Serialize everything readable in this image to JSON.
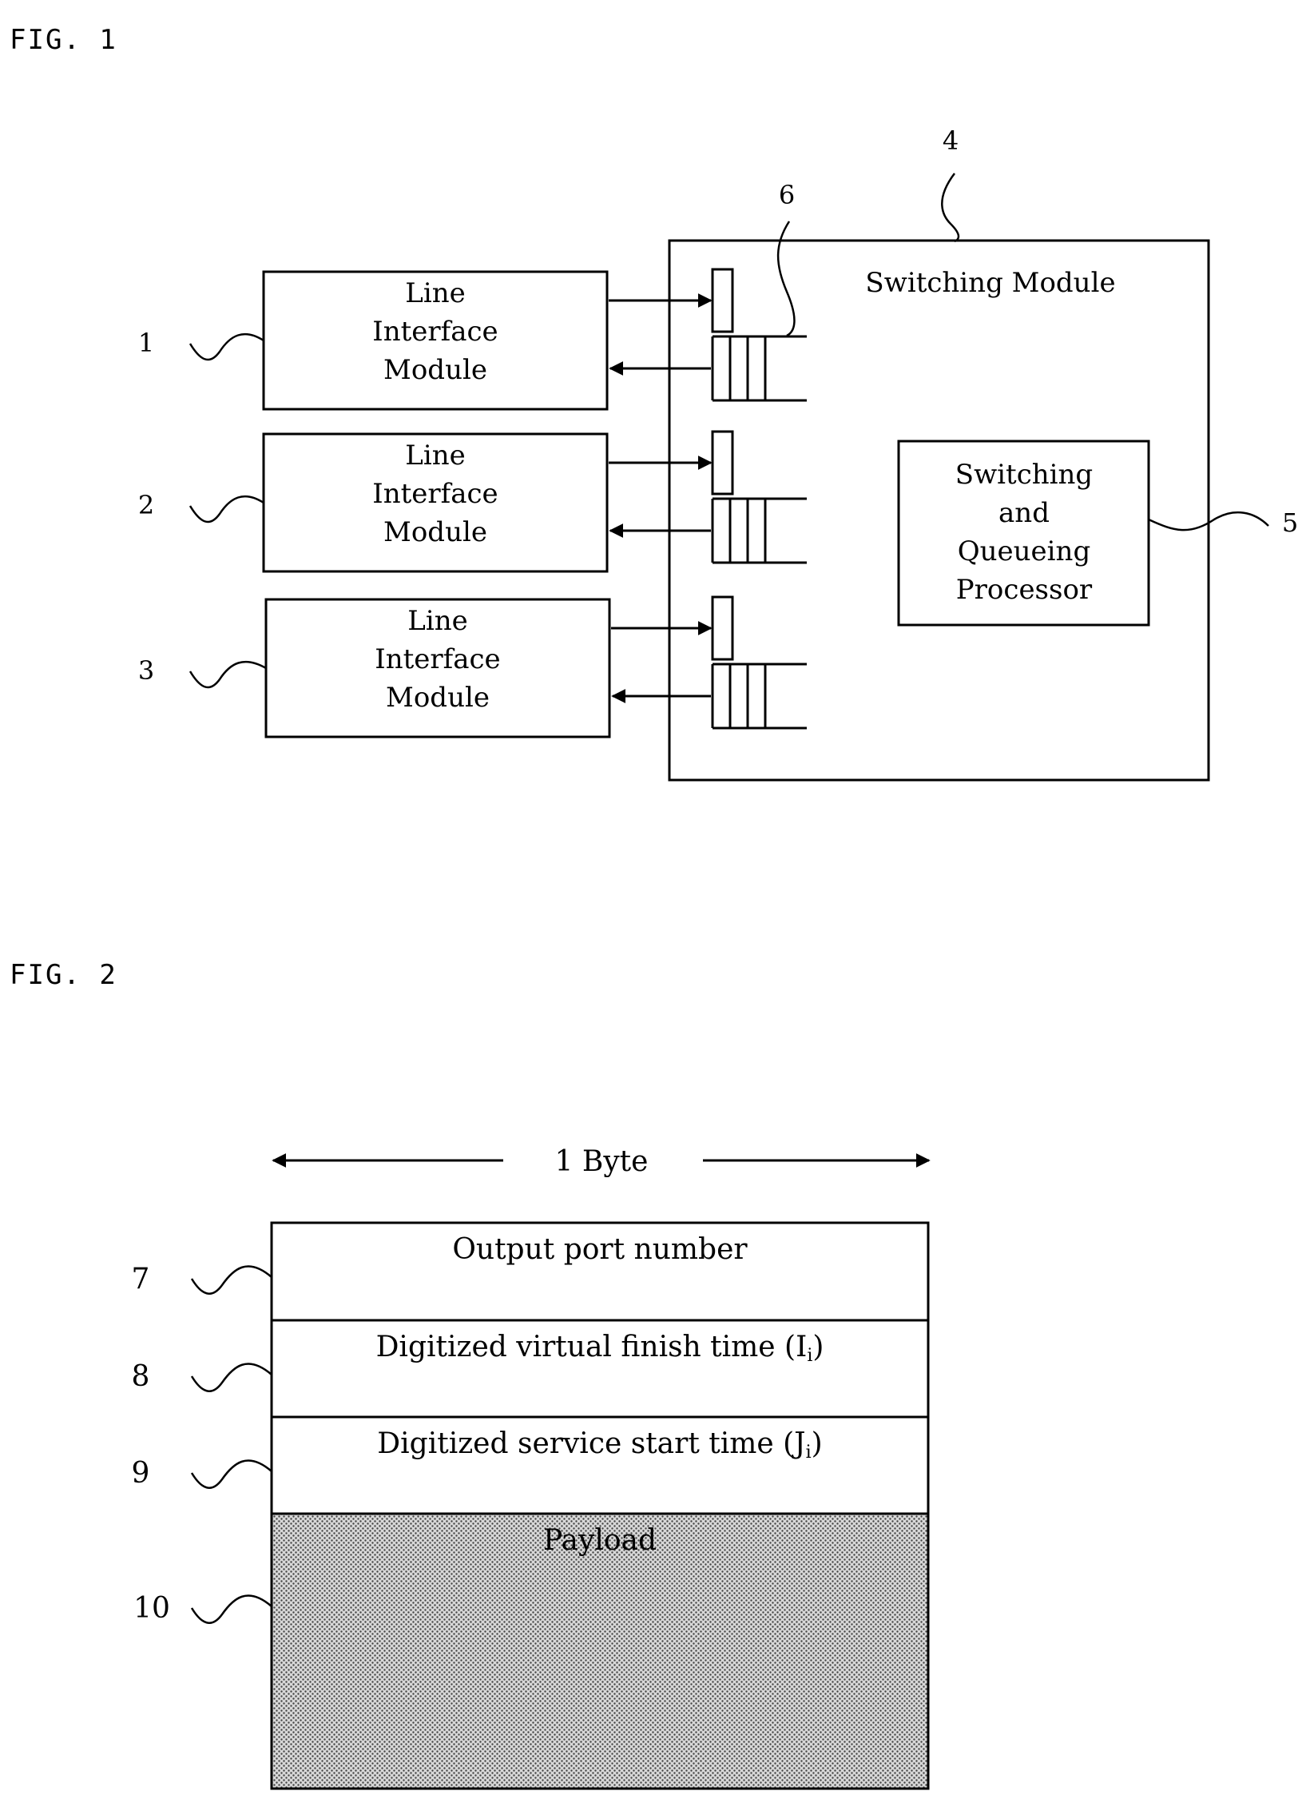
{
  "fig1": {
    "title": "FIG. 1",
    "line_interface_modules": [
      {
        "ref": "1",
        "lines": [
          "Line",
          "Interface",
          "Module"
        ]
      },
      {
        "ref": "2",
        "lines": [
          "Line",
          "Interface",
          "Module"
        ]
      },
      {
        "ref": "3",
        "lines": [
          "Line",
          "Interface",
          "Module"
        ]
      }
    ],
    "switching_module": {
      "ref": "4",
      "label": "Switching Module"
    },
    "processor": {
      "ref": "5",
      "lines": [
        "Switching",
        "and",
        "Queueing",
        "Processor"
      ]
    },
    "queue_ref": "6"
  },
  "fig2": {
    "title": "FIG. 2",
    "width_label": "1 Byte",
    "fields": [
      {
        "ref": "7",
        "label": "Output port number",
        "subscript": ""
      },
      {
        "ref": "8",
        "label": "Digitized virtual finish time (I",
        "subscript": "i",
        "suffix": ")"
      },
      {
        "ref": "9",
        "label": "Digitized service start time (J",
        "subscript": "i",
        "suffix": ")"
      },
      {
        "ref": "10",
        "label": "Payload",
        "subscript": "",
        "shaded": true
      }
    ]
  }
}
